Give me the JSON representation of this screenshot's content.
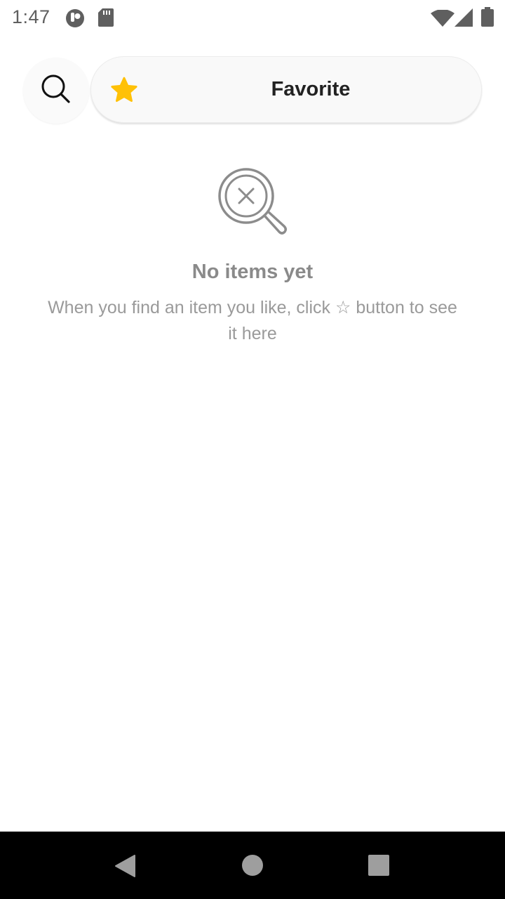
{
  "status_bar": {
    "time": "1:47",
    "icons": [
      "app-notification-icon",
      "sd-card-icon",
      "wifi-icon",
      "cellular-signal-icon",
      "battery-icon"
    ]
  },
  "header": {
    "search_icon": "search-icon",
    "tab_icon": "star-icon",
    "tab_label": "Favorite"
  },
  "empty_state": {
    "icon": "search-no-results-icon",
    "title": "No items yet",
    "description": "When you find an item you like, click ☆ button to see it here"
  },
  "nav_bar": {
    "buttons": [
      "back-icon",
      "home-icon",
      "recents-icon"
    ]
  },
  "colors": {
    "star": "#FFC107",
    "title_text": "#222222",
    "muted_text": "#9a9a9a",
    "nav_background": "#000000"
  }
}
